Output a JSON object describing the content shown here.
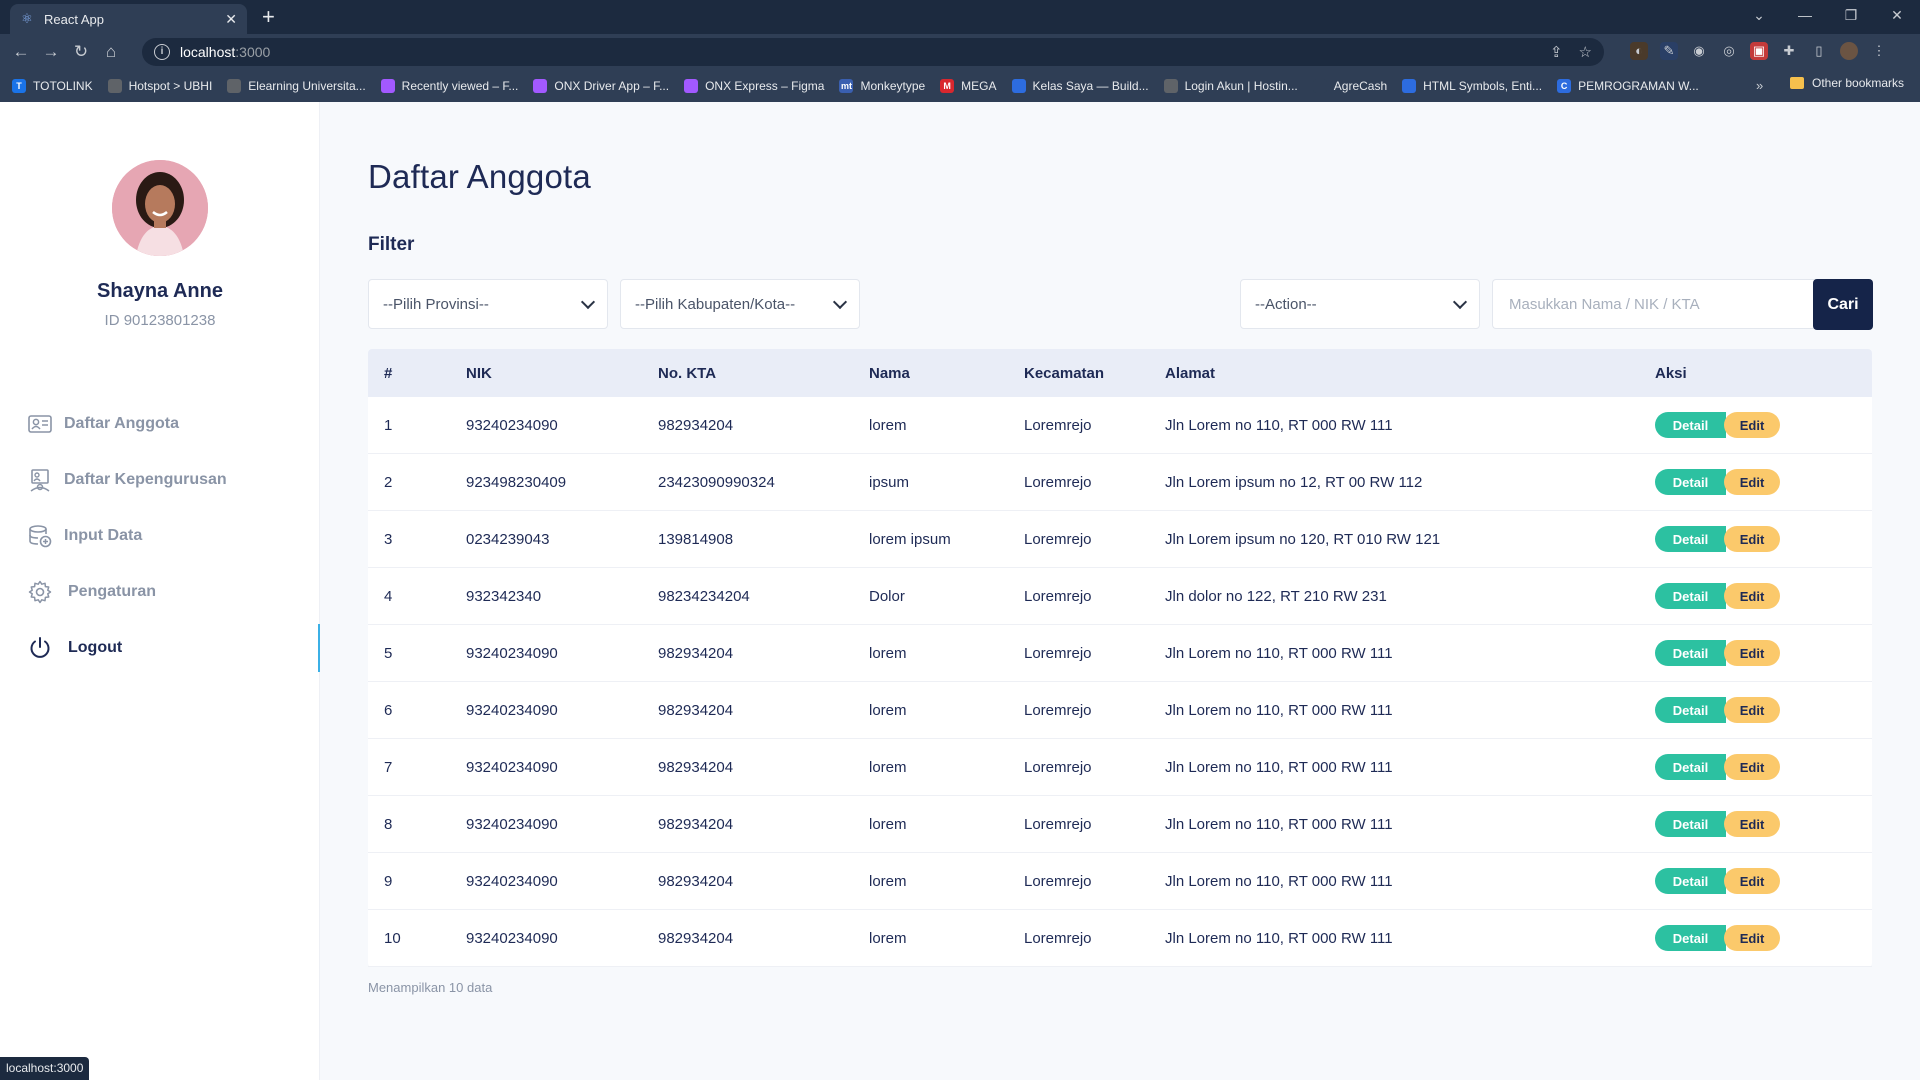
{
  "browser": {
    "tab_title": "React App",
    "url_host": "localhost",
    "url_port": ":3000",
    "bookmarks": [
      {
        "label": "TOTOLINK",
        "color": "#1a73e8",
        "icon": "T"
      },
      {
        "label": "Hotspot > UBHI",
        "color": "#5f6368",
        "icon": ""
      },
      {
        "label": "Elearning Universita...",
        "color": "#5f6368",
        "icon": ""
      },
      {
        "label": "Recently viewed – F...",
        "color": "#a259ff",
        "icon": ""
      },
      {
        "label": "ONX Driver App – F...",
        "color": "#a259ff",
        "icon": ""
      },
      {
        "label": "ONX Express – Figma",
        "color": "#a259ff",
        "icon": ""
      },
      {
        "label": "Monkeytype",
        "color": "#3a5fb0",
        "icon": "mt"
      },
      {
        "label": "MEGA",
        "color": "#d9272e",
        "icon": "M"
      },
      {
        "label": "Kelas Saya — Build...",
        "color": "#2d6cdf",
        "icon": ""
      },
      {
        "label": "Login Akun | Hostin...",
        "color": "#5f6368",
        "icon": ""
      },
      {
        "label": "AgreCash",
        "color": "#2f3e55",
        "icon": ""
      },
      {
        "label": "HTML Symbols, Enti...",
        "color": "#2d6cdf",
        "icon": ""
      },
      {
        "label": "PEMROGRAMAN W...",
        "color": "#2d6cdf",
        "icon": "C"
      }
    ],
    "other_bookmarks": "Other bookmarks",
    "status_url": "localhost:3000"
  },
  "profile": {
    "name": "Shayna Anne",
    "id": "ID 90123801238"
  },
  "menu": [
    {
      "label": "Daftar Anggota",
      "icon": "member-card-icon"
    },
    {
      "label": "Daftar Kepengurusan",
      "icon": "org-board-icon"
    },
    {
      "label": "Input Data",
      "icon": "database-add-icon"
    },
    {
      "label": "Pengaturan",
      "icon": "gear-icon"
    },
    {
      "label": "Logout",
      "icon": "power-icon"
    }
  ],
  "page": {
    "title": "Daftar Anggota",
    "filter_label": "Filter",
    "select_provinsi": "--Pilih Provinsi--",
    "select_kabupaten": "--Pilih Kabupaten/Kota--",
    "select_action": "--Action--",
    "search_placeholder": "Masukkan Nama / NIK / KTA",
    "search_button": "Cari",
    "footer_note": "Menampilkan 10 data"
  },
  "table": {
    "headers": [
      "#",
      "NIK",
      "No. KTA",
      "Nama",
      "Kecamatan",
      "Alamat",
      "Aksi"
    ],
    "detail_label": "Detail",
    "edit_label": "Edit",
    "rows": [
      [
        "1",
        "93240234090",
        "982934204",
        "lorem",
        "Loremrejo",
        "Jln Lorem no 110, RT 000 RW 111"
      ],
      [
        "2",
        "923498230409",
        "23423090990324",
        "ipsum",
        "Loremrejo",
        "Jln Lorem ipsum no 12, RT 00 RW 112"
      ],
      [
        "3",
        "0234239043",
        "139814908",
        "lorem ipsum",
        "Loremrejo",
        "Jln Lorem ipsum no 120, RT 010 RW 121"
      ],
      [
        "4",
        "932342340",
        "98234234204",
        "Dolor",
        "Loremrejo",
        "Jln dolor no 122, RT 210 RW 231"
      ],
      [
        "5",
        "93240234090",
        "982934204",
        "lorem",
        "Loremrejo",
        "Jln Lorem no 110, RT 000 RW 111"
      ],
      [
        "6",
        "93240234090",
        "982934204",
        "lorem",
        "Loremrejo",
        "Jln Lorem no 110, RT 000 RW 111"
      ],
      [
        "7",
        "93240234090",
        "982934204",
        "lorem",
        "Loremrejo",
        "Jln Lorem no 110, RT 000 RW 111"
      ],
      [
        "8",
        "93240234090",
        "982934204",
        "lorem",
        "Loremrejo",
        "Jln Lorem no 110, RT 000 RW 111"
      ],
      [
        "9",
        "93240234090",
        "982934204",
        "lorem",
        "Loremrejo",
        "Jln Lorem no 110, RT 000 RW 111"
      ],
      [
        "10",
        "93240234090",
        "982934204",
        "lorem",
        "Loremrejo",
        "Jln Lorem no 110, RT 000 RW 111"
      ]
    ]
  },
  "colors": {
    "primary": "#152449",
    "detail": "#2cc1a1",
    "edit": "#fbc96b",
    "active_indicator": "#3bb0e6"
  }
}
